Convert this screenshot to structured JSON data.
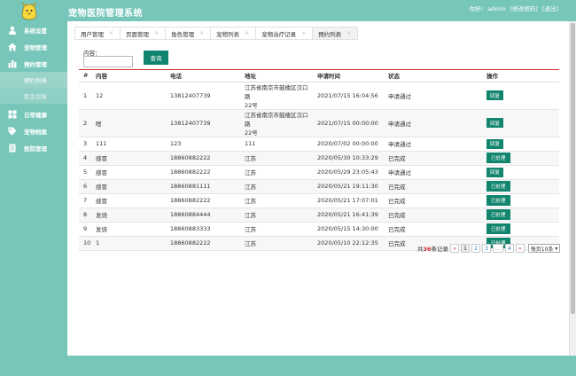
{
  "header": {
    "title": "宠物医院管理系统",
    "greeting": "你好!",
    "user": "admin",
    "change_password": "[修改密码]",
    "logout": "[退出]"
  },
  "sidebar": {
    "items": [
      {
        "label": "系统设置",
        "icon": "user-icon"
      },
      {
        "label": "宠物管理",
        "icon": "home-icon"
      },
      {
        "label": "预约管理",
        "icon": "grid-icon"
      }
    ],
    "subitems": [
      {
        "label": "预约列表",
        "active": true
      },
      {
        "label": "医生回复",
        "active": false
      }
    ],
    "items2": [
      {
        "label": "日常健康",
        "icon": "grid-icon"
      },
      {
        "label": "宠物档案",
        "icon": "tag-icon"
      },
      {
        "label": "医院管理",
        "icon": "document-icon"
      }
    ]
  },
  "tabs": [
    {
      "label": "用户管理"
    },
    {
      "label": "页面管理"
    },
    {
      "label": "角色管理"
    },
    {
      "label": "宠物列表"
    },
    {
      "label": "宠物治疗记录"
    },
    {
      "label": "预约列表"
    }
  ],
  "search": {
    "label": "内容：",
    "value": "",
    "button": "查询"
  },
  "table": {
    "headers": [
      "#",
      "内容",
      "电话",
      "地址",
      "申请时间",
      "状态",
      "操作"
    ],
    "rows": [
      {
        "no": "1",
        "content": "12",
        "phone": "13812407739",
        "addr1": "江苏省南京市鼓楼区汉口路",
        "addr2": "22号",
        "time": "2021/07/15 16:04:56",
        "status": "申请通过",
        "op": "回复"
      },
      {
        "no": "2",
        "content": "嗯",
        "phone": "13812407739",
        "addr1": "江苏省南京市鼓楼区汉口路",
        "addr2": "22号",
        "time": "2021/07/15 00:00:00",
        "status": "申请通过",
        "op": "回复"
      },
      {
        "no": "3",
        "content": "111",
        "phone": "123",
        "addr1": "111",
        "addr2": "",
        "time": "2020/07/02 00:00:00",
        "status": "申请通过",
        "op": "回复"
      },
      {
        "no": "4",
        "content": "感冒",
        "phone": "18860882222",
        "addr1": "江苏",
        "addr2": "",
        "time": "2020/05/30 10:33:29",
        "status": "已完成",
        "op": "已处理"
      },
      {
        "no": "5",
        "content": "感冒",
        "phone": "18860882222",
        "addr1": "江苏",
        "addr2": "",
        "time": "2020/05/29 23:05:43",
        "status": "申请通过",
        "op": "回复"
      },
      {
        "no": "6",
        "content": "感冒",
        "phone": "18860881111",
        "addr1": "江苏",
        "addr2": "",
        "time": "2020/05/21 19:11:30",
        "status": "已完成",
        "op": "已处理"
      },
      {
        "no": "7",
        "content": "感冒",
        "phone": "18860882222",
        "addr1": "江苏",
        "addr2": "",
        "time": "2020/05/21 17:07:01",
        "status": "已完成",
        "op": "已处理"
      },
      {
        "no": "8",
        "content": "发烧",
        "phone": "18860884444",
        "addr1": "江苏",
        "addr2": "",
        "time": "2020/05/21 16:41:39",
        "status": "已完成",
        "op": "已处理"
      },
      {
        "no": "9",
        "content": "发烧",
        "phone": "18860883333",
        "addr1": "江苏",
        "addr2": "",
        "time": "2020/05/15 14:30:00",
        "status": "已完成",
        "op": "已处理"
      },
      {
        "no": "10",
        "content": "1",
        "phone": "18860882222",
        "addr1": "江苏",
        "addr2": "",
        "time": "2020/05/10 22:12:35",
        "status": "已完成",
        "op": "已处理"
      }
    ]
  },
  "pager": {
    "prefix": "共",
    "total": "36",
    "suffix": "条记录",
    "prev": "«",
    "pages": [
      "1",
      "2",
      "3",
      "...",
      "4"
    ],
    "next": "»",
    "page_size": "每页10条"
  },
  "colors": {
    "theme": "#76c6ba",
    "button": "#11856e",
    "accent_red": "#c9302c"
  }
}
